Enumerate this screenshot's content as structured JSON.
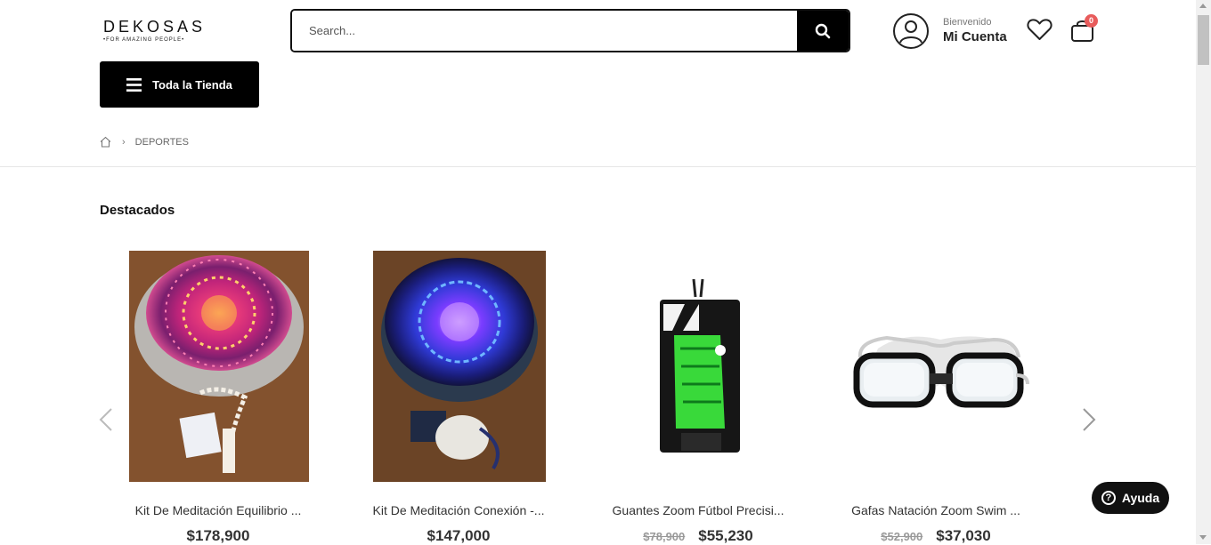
{
  "header": {
    "logo_main": "DEKOSAS",
    "logo_sub": "FOR AMAZING PEOPLE",
    "search_placeholder": "Search...",
    "welcome": "Bienvenido",
    "account_label": "Mi Cuenta",
    "cart_count": "0"
  },
  "nav": {
    "store_label": "Toda la Tienda"
  },
  "breadcrumb": {
    "current": "DEPORTES"
  },
  "section": {
    "title": "Destacados"
  },
  "products": [
    {
      "name": "Kit De Meditación Equilibrio ...",
      "old_price": "",
      "price": "$178,900"
    },
    {
      "name": "Kit De Meditación Conexión -...",
      "old_price": "",
      "price": "$147,000"
    },
    {
      "name": "Guantes Zoom Fútbol Precisi...",
      "old_price": "$78,900",
      "price": "$55,230"
    },
    {
      "name": "Gafas Natación Zoom Swim ...",
      "old_price": "$52,900",
      "price": "$37,030"
    }
  ],
  "help": {
    "label": "Ayuda"
  },
  "colors": {
    "accent": "#000000",
    "badge": "#e85c5c"
  }
}
